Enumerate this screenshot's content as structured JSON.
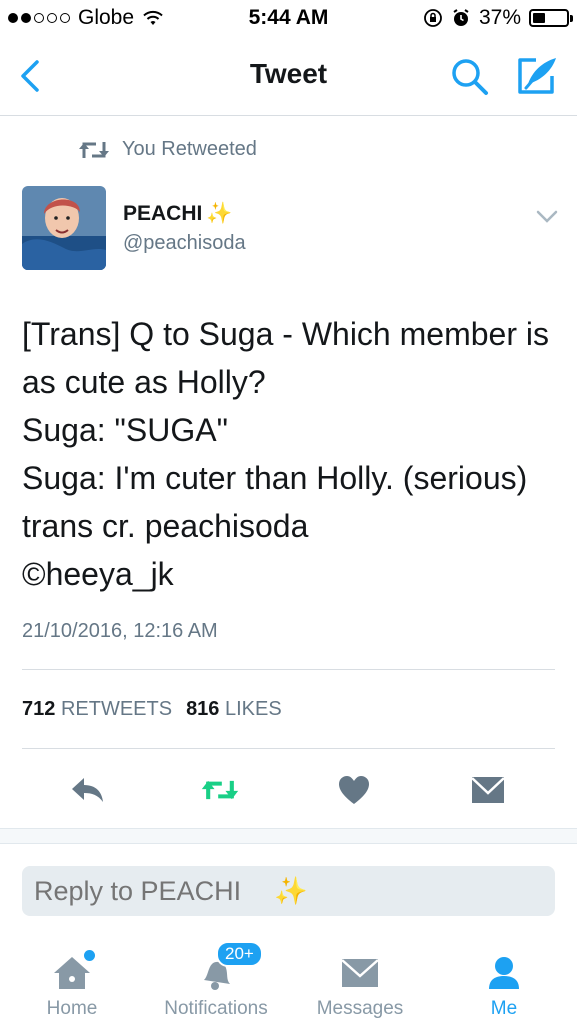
{
  "status_bar": {
    "carrier": "Globe",
    "signal_dots_filled": 2,
    "signal_dots_total": 5,
    "time": "5:44 AM",
    "battery_percent": "37%",
    "battery_level": 0.37
  },
  "nav": {
    "title": "Tweet",
    "back_icon": "chevron-left-icon",
    "search_icon": "search-icon",
    "compose_icon": "compose-icon",
    "accent_color": "#1da1f2"
  },
  "tweet": {
    "retweet_context": "You Retweeted",
    "author_name": "PEACHI",
    "author_emoji": "✨",
    "author_handle": "@peachisoda",
    "text": "[Trans] Q to Suga - Which member is as cute as Holly?\nSuga: \"SUGA\"\nSuga: I'm cuter than Holly. (serious)\ntrans cr. peachisoda\n©heeya_jk",
    "timestamp": "21/10/2016, 12:16 AM",
    "retweet_count": "712",
    "retweet_label": "RETWEETS",
    "like_count": "816",
    "like_label": "LIKES",
    "retweet_color": "#19cf86"
  },
  "actions": [
    "reply-icon",
    "retweet-icon",
    "like-icon",
    "dm-icon"
  ],
  "reply": {
    "placeholder": "Reply to PEACHI",
    "emoji": "✨"
  },
  "tab_bar": {
    "tabs": [
      {
        "label": "Home",
        "icon": "home-icon"
      },
      {
        "label": "Notifications",
        "icon": "bell-icon",
        "badge": "20+"
      },
      {
        "label": "Messages",
        "icon": "envelope-icon"
      },
      {
        "label": "Me",
        "icon": "person-icon"
      }
    ],
    "active": "Me"
  }
}
